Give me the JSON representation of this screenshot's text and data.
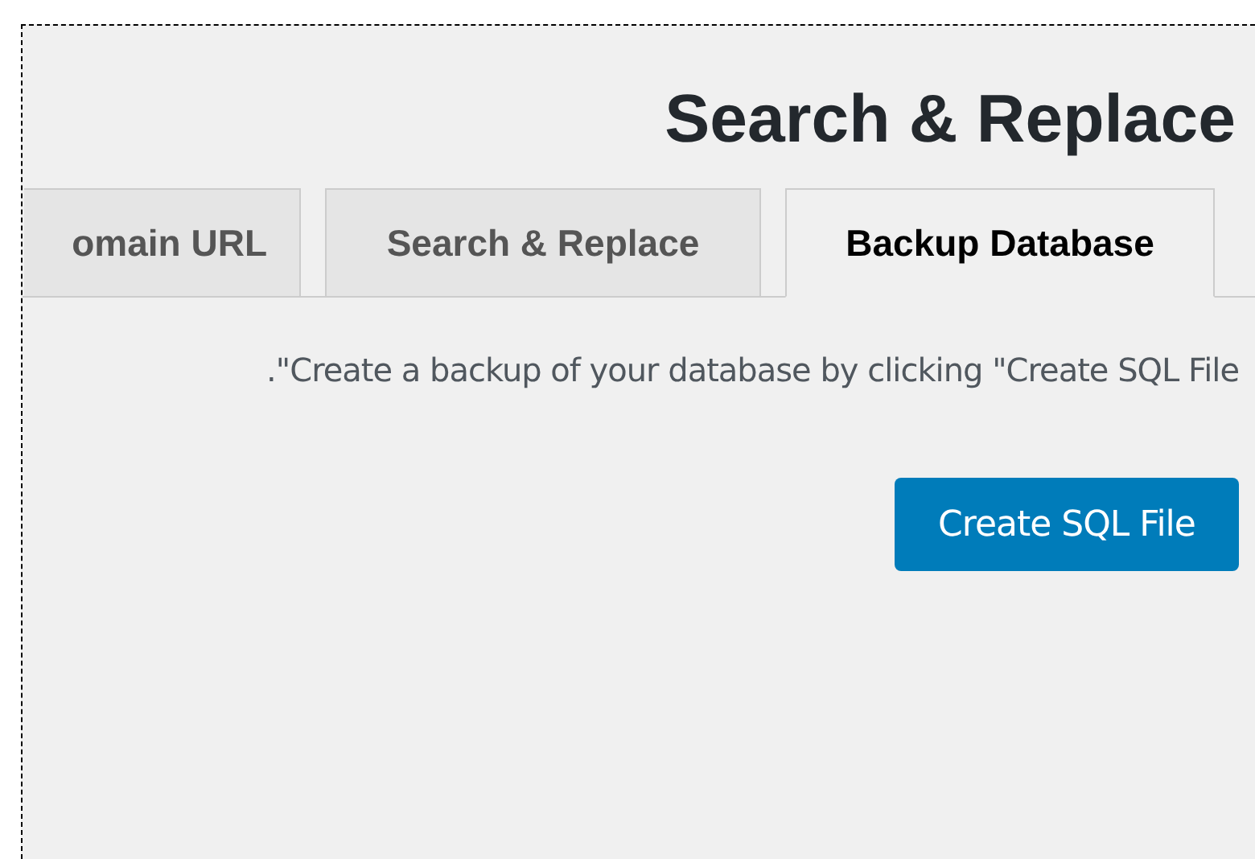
{
  "heading": "Search & Replace",
  "tabs": [
    {
      "label": "omain URL",
      "selected": false
    },
    {
      "label": "Search & Replace",
      "selected": false
    },
    {
      "label": "Backup Database",
      "selected": true
    }
  ],
  "description": ".\"Create a backup of your database by clicking \"Create SQL File",
  "button": "Create SQL File"
}
